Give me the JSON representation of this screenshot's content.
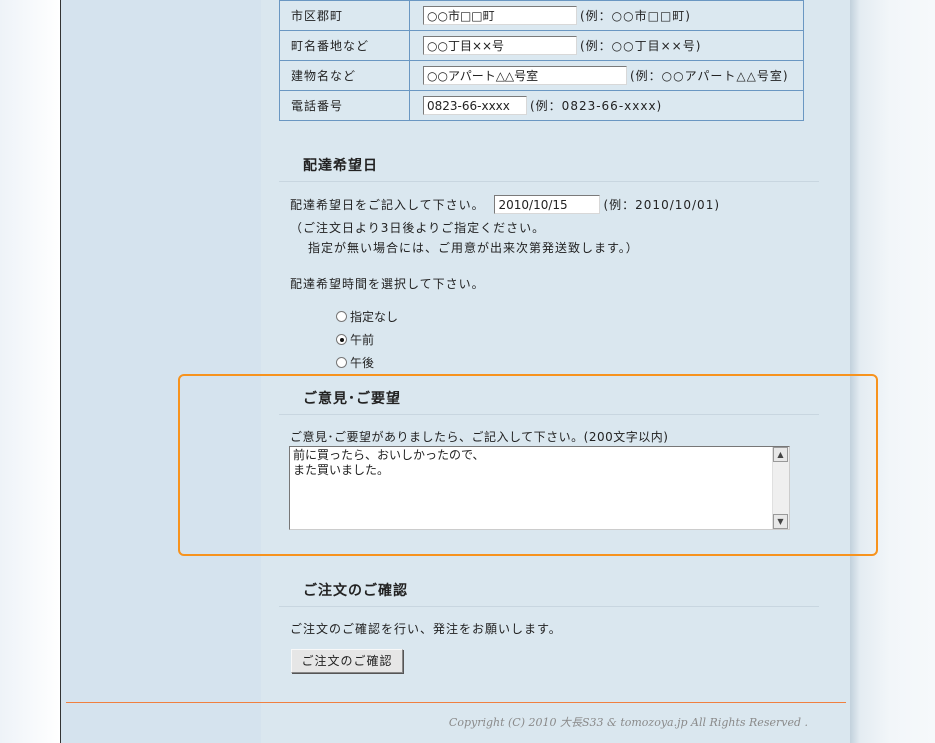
{
  "address_rows": [
    {
      "label": "市区郡町",
      "value": "○○市□□町",
      "example": "(例：○○市□□町)"
    },
    {
      "label": "町名番地など",
      "value": "○○丁目××号",
      "example": "(例：○○丁目××号)"
    },
    {
      "label": "建物名など",
      "value": "○○アパート△△号室",
      "example": "(例：○○アパート△△号室)"
    },
    {
      "label": "電話番号",
      "value": "0823-66-xxxx",
      "example": "(例：0823-66-xxxx)"
    }
  ],
  "delivery": {
    "title": "配達希望日",
    "date_prompt": "配達希望日をご記入して下さい。",
    "date_value": "2010/10/15",
    "date_example": "(例：2010/10/01)",
    "note_line1": "（ご注文日より3日後よりご指定ください。",
    "note_line2": "指定が無い場合には、ご用意が出来次第発送致します。）",
    "time_prompt": "配達希望時間を選択して下さい。",
    "options": [
      "指定なし",
      "午前",
      "午後"
    ],
    "selected": "午前"
  },
  "comments": {
    "title": "ご意見･ご要望",
    "prompt": "ご意見･ご要望がありましたら、ご記入して下さい。(200文字以内)",
    "text_line1": "前に買ったら、おいしかったので、",
    "text_line2": "また買いました。",
    "highlight_color": "#f7931e"
  },
  "confirm": {
    "title": "ご注文のご確認",
    "text": "ご注文のご確認を行い、発注をお願いします。",
    "button_label": "ご注文のご確認"
  },
  "footer": {
    "copyright": "Copyright (C) 2010 大長S33 & tomozoya.jp All Rights Reserved ."
  }
}
